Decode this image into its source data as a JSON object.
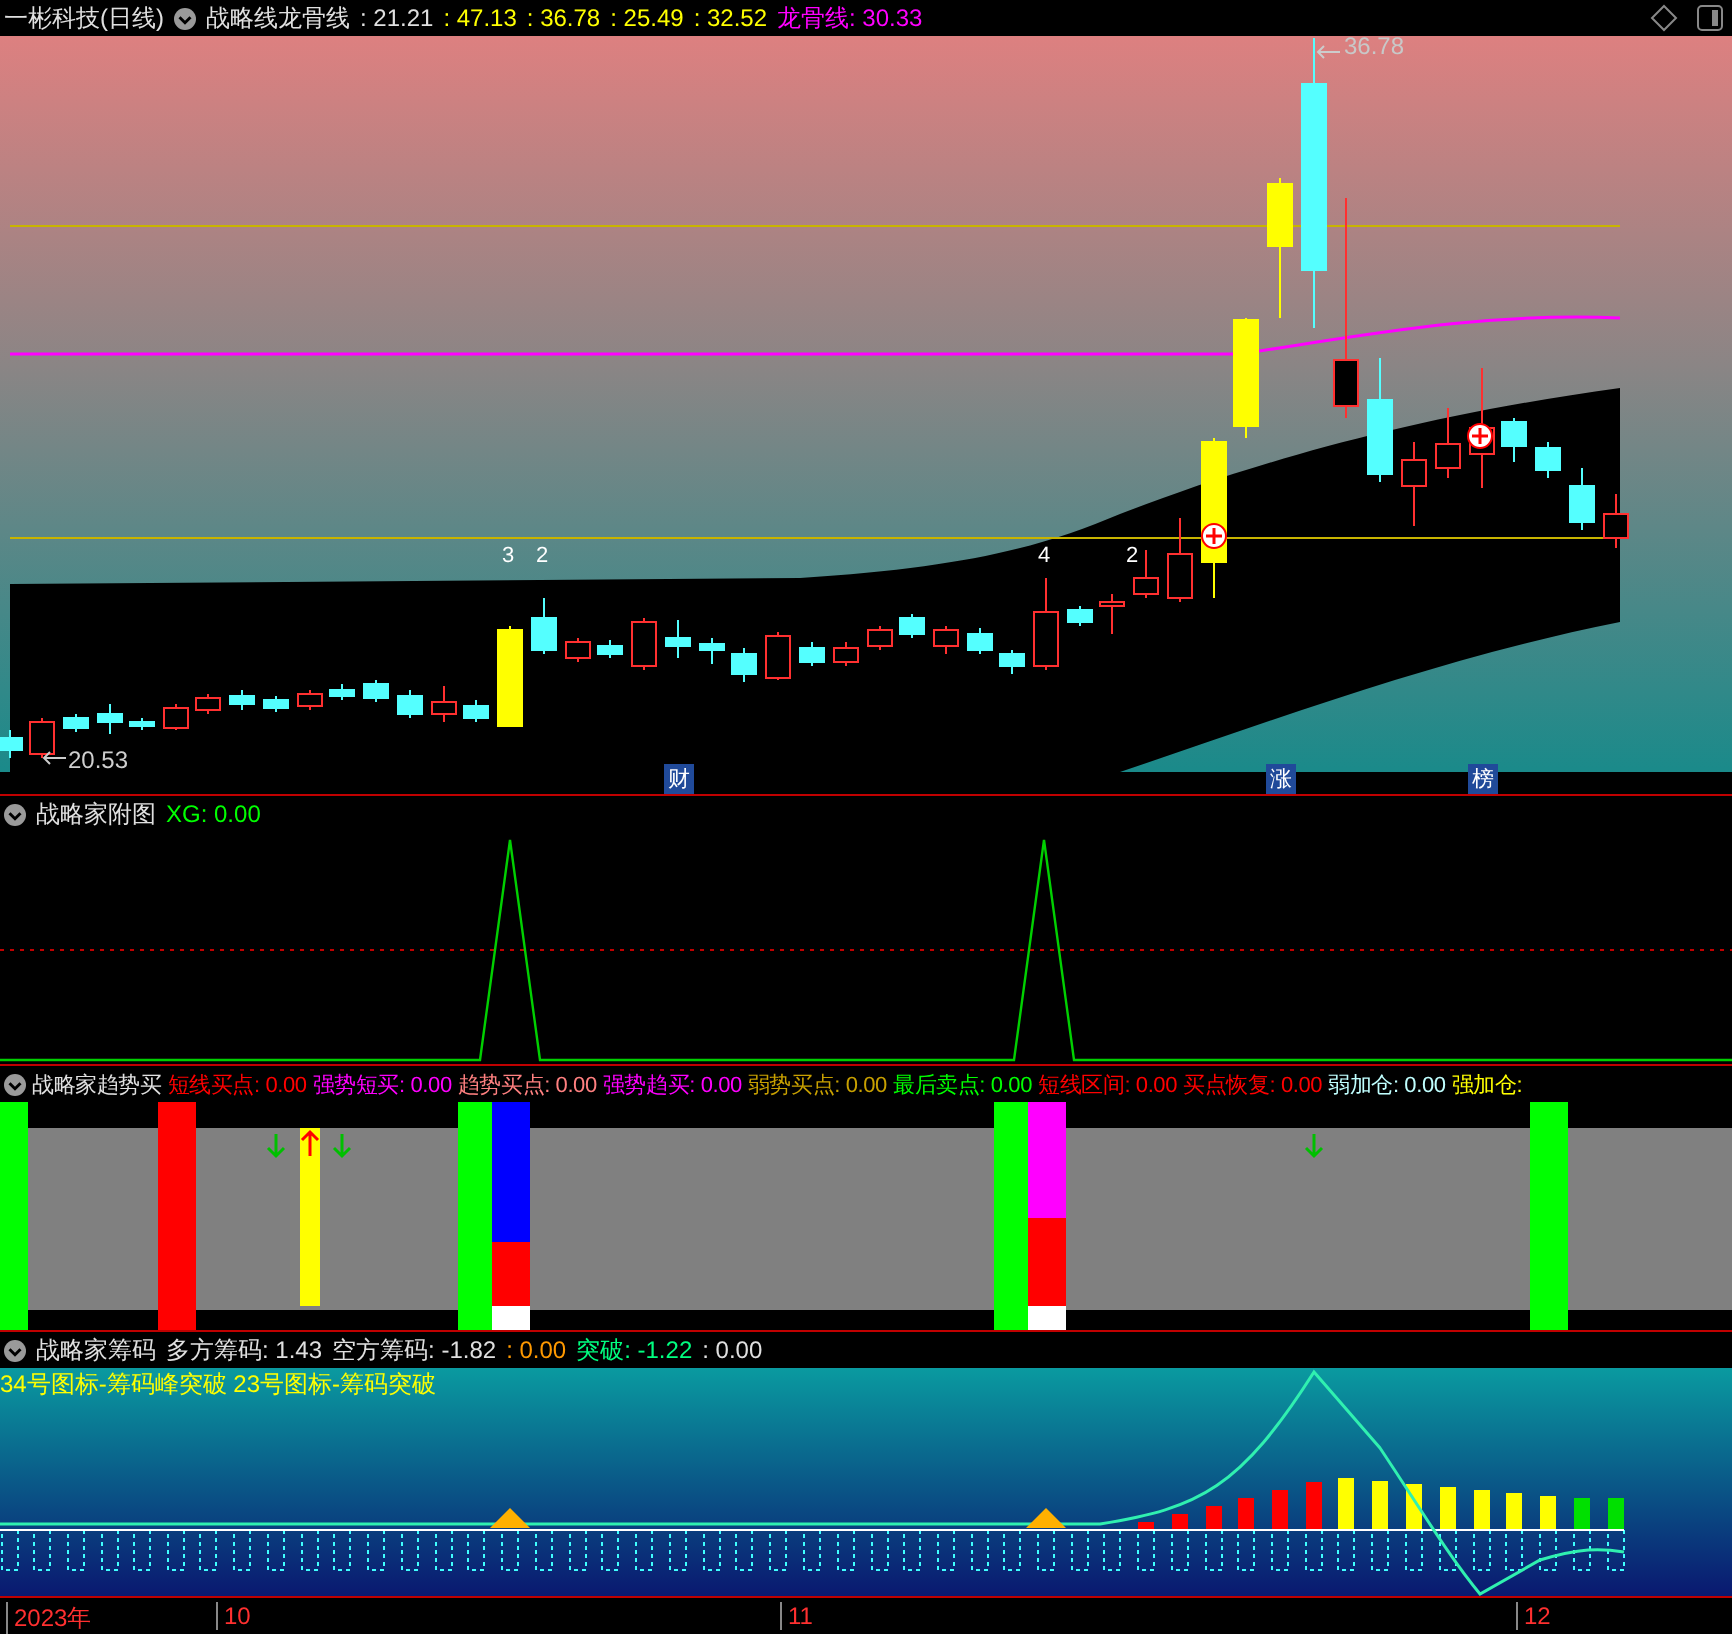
{
  "main_panel": {
    "security": "一彬科技(日线)",
    "indicator": "战略线龙骨线",
    "values": [
      {
        "text": ": 21.21",
        "color": "#e0e0e0"
      },
      {
        "text": ": 47.13",
        "color": "#ffff00"
      },
      {
        "text": ": 36.78",
        "color": "#ffff00"
      },
      {
        "text": ": 25.49",
        "color": "#ffff00"
      },
      {
        "text": ": 32.52",
        "color": "#ffff00"
      },
      {
        "text": "龙骨线: 30.33",
        "color": "#ff00ff"
      }
    ],
    "high_label": "36.78",
    "low_label": "20.53",
    "wave_labels": [
      "3",
      "2",
      "4",
      "2"
    ],
    "badges": [
      "财",
      "涨",
      "榜"
    ]
  },
  "sub_panel": {
    "title": "战略家附图",
    "values": [
      {
        "text": "XG: 0.00",
        "color": "#00ff00"
      }
    ]
  },
  "trend_panel": {
    "title": "战略家趋势买",
    "values": [
      {
        "text": "短线买点: 0.00",
        "color": "#ff0000"
      },
      {
        "text": "强势短买: 0.00",
        "color": "#ff00ff"
      },
      {
        "text": "趋势买点: 0.00",
        "color": "#ff8080"
      },
      {
        "text": "强势趋买: 0.00",
        "color": "#ff00ff"
      },
      {
        "text": "弱势买点: 0.00",
        "color": "#c8a000"
      },
      {
        "text": "最后卖点: 0.00",
        "color": "#00ff00"
      },
      {
        "text": "短线区间: 0.00",
        "color": "#ff0000"
      },
      {
        "text": "买点恢复: 0.00",
        "color": "#ff0000"
      },
      {
        "text": "弱加仓: 0.00",
        "color": "#c0ffff"
      },
      {
        "text": "强加仓:",
        "color": "#ffff00"
      }
    ]
  },
  "chip_panel": {
    "title": "战略家筹码",
    "values": [
      {
        "text": "多方筹码: 1.43",
        "color": "#e0e0e0"
      },
      {
        "text": "空方筹码: -1.82",
        "color": "#e0e0e0"
      },
      {
        "text": ": 0.00",
        "color": "#ff9900"
      },
      {
        "text": "突破: -1.22",
        "color": "#00ff80"
      },
      {
        "text": ": 0.00",
        "color": "#e0e0e0"
      }
    ],
    "legend": "34号图标-筹码峰突破 23号图标-筹码突破"
  },
  "time_axis": [
    "2023年",
    "10",
    "11",
    "12"
  ]
}
